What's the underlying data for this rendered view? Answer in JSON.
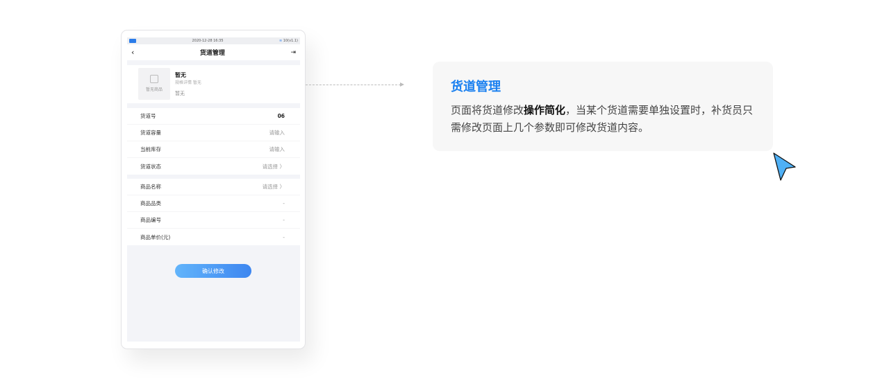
{
  "status_bar": {
    "logo": "易邦",
    "datetime": "2020-12-28 16:35",
    "signal": "10(v1.1)"
  },
  "nav": {
    "title": "货道管理"
  },
  "product": {
    "thumb_label": "暂无商品",
    "name": "暂无",
    "spec": "规格详情 暂无",
    "extra": "暂无"
  },
  "section1": [
    {
      "label": "货道号",
      "value": "06"
    },
    {
      "label": "货道容量",
      "value": "请输入"
    },
    {
      "label": "当前库存",
      "value": "请输入"
    },
    {
      "label": "货道状态",
      "value": "请选择 〉"
    }
  ],
  "section2": [
    {
      "label": "商品名称",
      "value": "请选择 〉"
    },
    {
      "label": "商品品类",
      "value": "-"
    },
    {
      "label": "商品编号",
      "value": "-"
    },
    {
      "label": "商品单价(元)",
      "value": "-"
    }
  ],
  "confirm_label": "确认修改",
  "info": {
    "title": "货道管理",
    "text_a": "页面将货道修改",
    "text_bold": "操作简化",
    "text_b": "，当某个货道需要单独设置时，补货员只需修改页面上几个参数即可修改货道内容。"
  },
  "colors": {
    "accent": "#1a80f0",
    "button_start": "#62b4fb",
    "button_end": "#3d86f0"
  }
}
